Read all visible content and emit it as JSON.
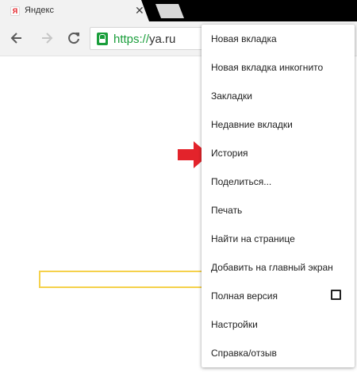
{
  "tab": {
    "favicon": "Я",
    "title": "Яндекс",
    "close": "✕"
  },
  "toolbar": {
    "url_scheme": "https://",
    "url_host": "ya.ru"
  },
  "menu": {
    "items": [
      {
        "label": "Новая вкладка"
      },
      {
        "label": "Новая вкладка инкогнито"
      },
      {
        "label": "Закладки"
      },
      {
        "label": "Недавние вкладки"
      },
      {
        "label": "История"
      },
      {
        "label": "Поделиться..."
      },
      {
        "label": "Печать"
      },
      {
        "label": "Найти на странице"
      },
      {
        "label": "Добавить на главный экран"
      },
      {
        "label": "Полная версия",
        "checkbox": false
      },
      {
        "label": "Настройки"
      },
      {
        "label": "Справка/отзыв"
      }
    ]
  },
  "colors": {
    "secure_green": "#1a9e3b",
    "search_border": "#f5d14b",
    "arrow_red": "#e3232b"
  }
}
